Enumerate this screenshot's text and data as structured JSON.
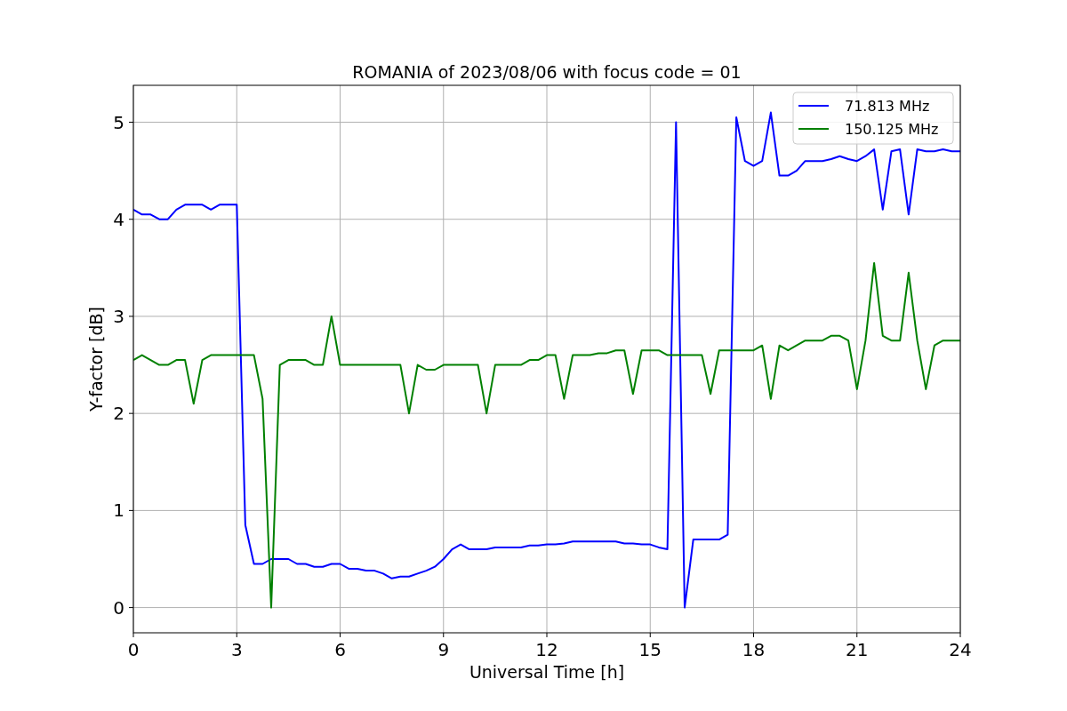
{
  "figure": {
    "chart_data": {
      "type": "line",
      "title": "ROMANIA of 2023/08/06 with focus code = 01",
      "xlabel": "Universal Time [h]",
      "ylabel": "Y-factor [dB]",
      "x": [
        0,
        0.25,
        0.5,
        0.75,
        1,
        1.25,
        1.5,
        1.75,
        2,
        2.25,
        2.5,
        2.75,
        3,
        3.25,
        3.5,
        3.75,
        4,
        4.25,
        4.5,
        4.75,
        5,
        5.25,
        5.5,
        5.75,
        6,
        6.25,
        6.5,
        6.75,
        7,
        7.25,
        7.5,
        7.75,
        8,
        8.25,
        8.5,
        8.75,
        9,
        9.25,
        9.5,
        9.75,
        10,
        10.25,
        10.5,
        10.75,
        11,
        11.25,
        11.5,
        11.75,
        12,
        12.25,
        12.5,
        12.75,
        13,
        13.25,
        13.5,
        13.75,
        14,
        14.25,
        14.5,
        14.75,
        15,
        15.25,
        15.5,
        15.75,
        16,
        16.25,
        16.5,
        16.75,
        17,
        17.25,
        17.5,
        17.75,
        18,
        18.25,
        18.5,
        18.75,
        19,
        19.25,
        19.5,
        19.75,
        20,
        20.25,
        20.5,
        20.75,
        21,
        21.25,
        21.5,
        21.75,
        22,
        22.25,
        22.5,
        22.75,
        23,
        23.25,
        23.5,
        23.75,
        24
      ],
      "series": [
        {
          "name": "71.813 MHz",
          "color": "#0000ff",
          "values": [
            4.1,
            4.05,
            4.05,
            4.0,
            4.0,
            4.1,
            4.15,
            4.15,
            4.15,
            4.1,
            4.15,
            4.15,
            4.15,
            0.85,
            0.45,
            0.45,
            0.5,
            0.5,
            0.5,
            0.45,
            0.45,
            0.42,
            0.42,
            0.45,
            0.45,
            0.4,
            0.4,
            0.38,
            0.38,
            0.35,
            0.3,
            0.32,
            0.32,
            0.35,
            0.38,
            0.42,
            0.5,
            0.6,
            0.65,
            0.6,
            0.6,
            0.6,
            0.62,
            0.62,
            0.62,
            0.62,
            0.64,
            0.64,
            0.65,
            0.65,
            0.66,
            0.68,
            0.68,
            0.68,
            0.68,
            0.68,
            0.68,
            0.66,
            0.66,
            0.65,
            0.65,
            0.62,
            0.6,
            5.0,
            0.0,
            0.7,
            0.7,
            0.7,
            0.7,
            0.75,
            5.05,
            4.6,
            4.55,
            4.6,
            5.1,
            4.45,
            4.45,
            4.5,
            4.6,
            4.6,
            4.6,
            4.62,
            4.65,
            4.62,
            4.6,
            4.65,
            4.72,
            4.1,
            4.7,
            4.72,
            4.05,
            4.72,
            4.7,
            4.7,
            4.72,
            4.7,
            4.7
          ]
        },
        {
          "name": "150.125 MHz",
          "color": "#008000",
          "values": [
            2.55,
            2.6,
            2.55,
            2.5,
            2.5,
            2.55,
            2.55,
            2.1,
            2.55,
            2.6,
            2.6,
            2.6,
            2.6,
            2.6,
            2.6,
            2.15,
            0.0,
            2.5,
            2.55,
            2.55,
            2.55,
            2.5,
            2.5,
            3.0,
            2.5,
            2.5,
            2.5,
            2.5,
            2.5,
            2.5,
            2.5,
            2.5,
            2.0,
            2.5,
            2.45,
            2.45,
            2.5,
            2.5,
            2.5,
            2.5,
            2.5,
            2.0,
            2.5,
            2.5,
            2.5,
            2.5,
            2.55,
            2.55,
            2.6,
            2.6,
            2.15,
            2.6,
            2.6,
            2.6,
            2.62,
            2.62,
            2.65,
            2.65,
            2.2,
            2.65,
            2.65,
            2.65,
            2.6,
            2.6,
            2.6,
            2.6,
            2.6,
            2.2,
            2.65,
            2.65,
            2.65,
            2.65,
            2.65,
            2.7,
            2.15,
            2.7,
            2.65,
            2.7,
            2.75,
            2.75,
            2.75,
            2.8,
            2.8,
            2.75,
            2.25,
            2.75,
            3.55,
            2.8,
            2.75,
            2.75,
            3.45,
            2.75,
            2.25,
            2.7,
            2.75,
            2.75,
            2.75
          ]
        }
      ],
      "grid": true,
      "legend": true,
      "xlim": [
        0,
        24
      ],
      "ylim": [
        -0.26,
        5.38
      ],
      "xticks": [
        0,
        3,
        6,
        9,
        12,
        15,
        18,
        21,
        24
      ],
      "yticks": [
        0,
        1,
        2,
        3,
        4,
        5
      ]
    }
  }
}
